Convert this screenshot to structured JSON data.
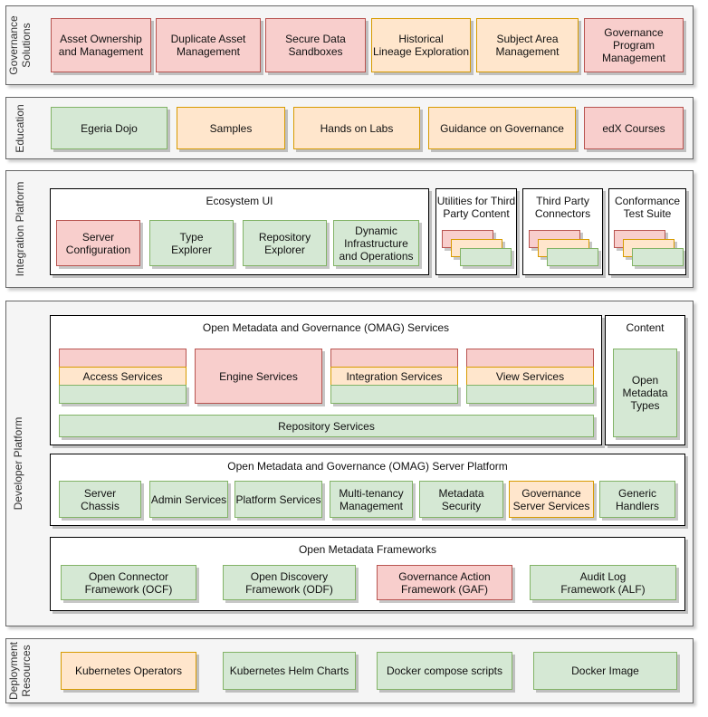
{
  "colors": {
    "red": "#f8cecc",
    "orange": "#ffe6cc",
    "green": "#d5e8d4",
    "section": "#f5f5f5"
  },
  "governance": {
    "label": "Governance\nSolutions",
    "items": [
      "Asset Ownership\nand Management",
      "Duplicate Asset\nManagement",
      "Secure Data\nSandboxes",
      "Historical\nLineage Exploration",
      "Subject Area\nManagement",
      "Governance\nProgram\nManagement"
    ]
  },
  "education": {
    "label": "Education",
    "items": [
      "Egeria Dojo",
      "Samples",
      "Hands on Labs",
      "Guidance on Governance",
      "edX Courses"
    ]
  },
  "integration": {
    "label": "Integration Platform",
    "ecosystem": {
      "title": "Ecosystem UI",
      "items": [
        "Server\nConfiguration",
        "Type\nExplorer",
        "Repository\nExplorer",
        "Dynamic\nInfrastructure\nand Operations"
      ]
    },
    "utilities": "Utilities for Third\nParty Content",
    "connectors": "Third Party\nConnectors",
    "conformance": "Conformance\nTest Suite"
  },
  "developer": {
    "label": "Developer Platform",
    "omag_services": {
      "title": "Open Metadata and Governance (OMAG) Services",
      "access": "Access Services",
      "engine": "Engine Services",
      "integration": "Integration Services",
      "view": "View Services",
      "repository": "Repository Services"
    },
    "content": {
      "title": "Content",
      "types": "Open\nMetadata\nTypes"
    },
    "platform": {
      "title": "Open Metadata and Governance (OMAG) Server Platform",
      "items": [
        "Server\nChassis",
        "Admin Services",
        "Platform Services",
        "Multi-tenancy\nManagement",
        "Metadata\nSecurity",
        "Governance\nServer Services",
        "Generic\nHandlers"
      ]
    },
    "frameworks": {
      "title": "Open Metadata Frameworks",
      "items": [
        "Open Connector\nFramework (OCF)",
        "Open Discovery\nFramework (ODF)",
        "Governance Action\nFramework (GAF)",
        "Audit Log\nFramework (ALF)"
      ]
    }
  },
  "deployment": {
    "label": "Deployment\nResources",
    "items": [
      "Kubernetes Operators",
      "Kubernetes Helm Charts",
      "Docker compose scripts",
      "Docker Image"
    ]
  }
}
